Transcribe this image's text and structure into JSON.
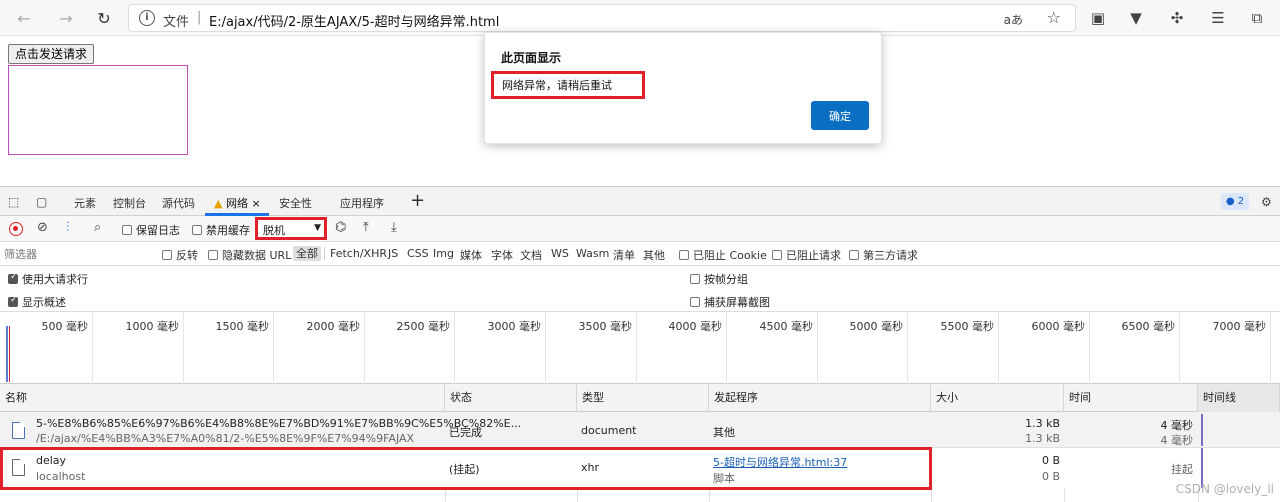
{
  "browser": {
    "address_prefix": "文件",
    "address_sep": "|",
    "url": "E:/ajax/代码/2-原生AJAX/5-超时与网络异常.html",
    "read_aloud": "aあ"
  },
  "page": {
    "send_button": "点击发送请求"
  },
  "dialog": {
    "title": "此页面显示",
    "message": "网络异常，请稍后重试",
    "ok_label": "确定"
  },
  "devtools": {
    "tabs": [
      {
        "label": "元素"
      },
      {
        "label": "控制台"
      },
      {
        "label": "源代码"
      },
      {
        "label": "网络"
      },
      {
        "label": "安全性"
      },
      {
        "label": "应用程序"
      }
    ],
    "close_tab": "×",
    "add_tab": "+",
    "issues_count": "2",
    "toolbar": {
      "preserve_log": "保留日志",
      "disable_cache": "禁用缓存",
      "throttle_value": "脱机"
    },
    "filter": {
      "placeholder": "筛选器",
      "invert": "反转",
      "hide_data_url": "隐藏数据 URL",
      "types": [
        "全部",
        "Fetch/XHR",
        "JS",
        "CSS",
        "Img",
        "媒体",
        "字体",
        "文档",
        "WS",
        "Wasm",
        "清单",
        "其他"
      ],
      "blocked_cookies": "已阻止 Cookie",
      "blocked_requests": "已阻止请求",
      "third_party": "第三方请求"
    },
    "options": {
      "big_rows": "使用大请求行",
      "overview": "显示概述",
      "group_by_frame": "按帧分组",
      "screenshots": "捕获屏幕截图"
    },
    "timeline_ticks": [
      "500 毫秒",
      "1000 毫秒",
      "1500 毫秒",
      "2000 毫秒",
      "2500 毫秒",
      "3000 毫秒",
      "3500 毫秒",
      "4000 毫秒",
      "4500 毫秒",
      "5000 毫秒",
      "5500 毫秒",
      "6000 毫秒",
      "6500 毫秒",
      "7000 毫秒"
    ],
    "columns": {
      "name": "名称",
      "status": "状态",
      "type": "类型",
      "initiator": "发起程序",
      "size": "大小",
      "time": "时间",
      "waterfall": "时间线"
    },
    "rows": [
      {
        "name": "5-%E8%B6%85%E6%97%B6%E4%B8%8E%E7%BD%91%E7%BB%9C%E5%BC%82%E...",
        "path": "/E:/ajax/%E4%BB%A3%E7%A0%81/2-%E5%8E%9F%E7%94%9FAJAX",
        "status": "已完成",
        "type": "document",
        "initiator": "其他",
        "size1": "1.3 kB",
        "size2": "1.3 kB",
        "time1": "4 毫秒",
        "time2": "4 毫秒"
      },
      {
        "name": "delay",
        "path": "localhost",
        "status": "(挂起)",
        "type": "xhr",
        "initiator": "5-超时与网络异常.html:37",
        "initiator_sub": "脚本",
        "size1": "0 B",
        "size2": "0 B",
        "time1": "挂起"
      }
    ]
  },
  "watermark": "CSDN @lovely_ll"
}
